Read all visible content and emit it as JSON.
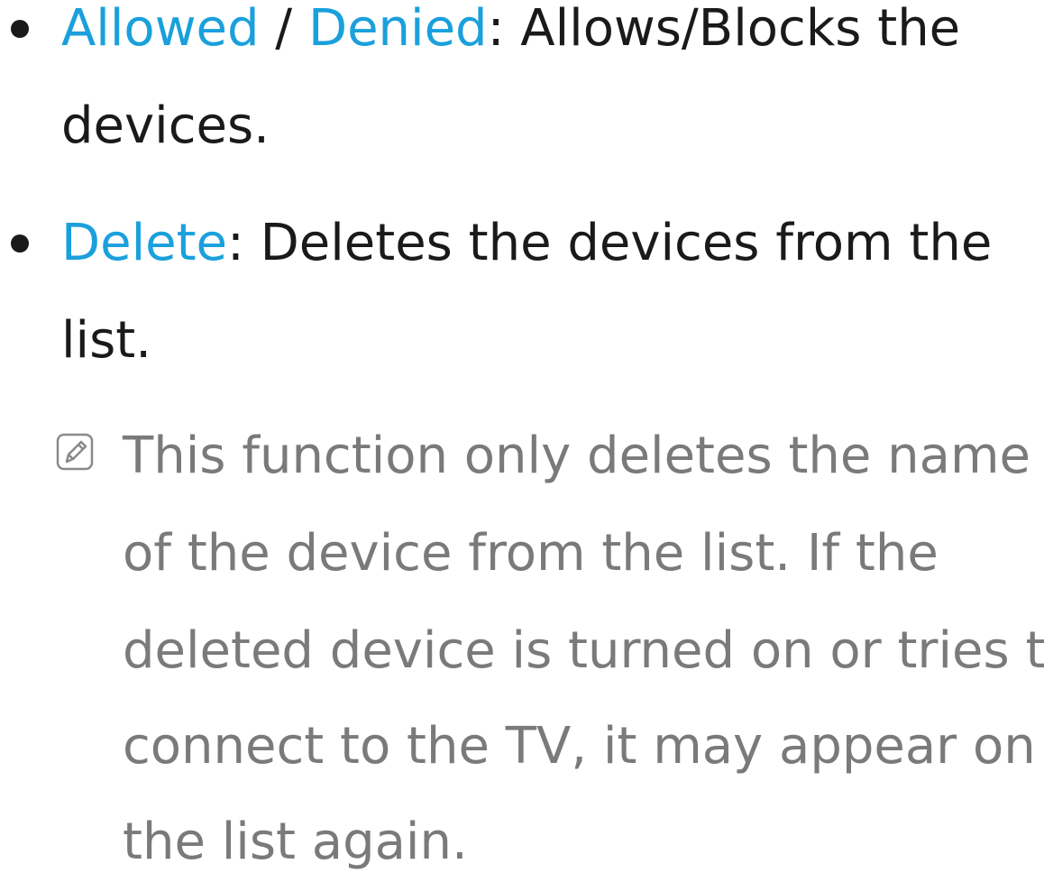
{
  "items": [
    {
      "keyword1": "Allowed",
      "sep": " / ",
      "keyword2": "Denied",
      "colon": ":",
      "line1_rest": " Allows/Blocks the",
      "line2": "devices."
    },
    {
      "keyword": "Delete",
      "colon": ":",
      "line1_rest": " Deletes the devices from the",
      "line2": "list."
    }
  ],
  "note": {
    "icon": "note-pencil-icon",
    "lines": [
      "This function only deletes the name",
      "of the device from the list. If the",
      "deleted device is turned on or tries to",
      "connect to the TV, it may appear on",
      "the list again."
    ]
  },
  "colors": {
    "keyword": "#1aa0dc",
    "body_text": "#1a1a1a",
    "note_text": "#7a7a7a"
  }
}
